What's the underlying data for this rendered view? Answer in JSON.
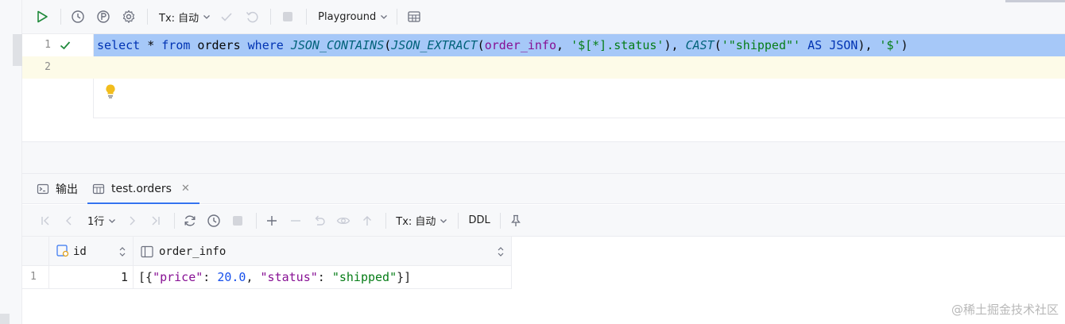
{
  "toolbar": {
    "tx_label": "Tx: 自动",
    "playground_label": "Playground"
  },
  "editor": {
    "lines": [
      {
        "number": "1"
      },
      {
        "number": "2"
      }
    ],
    "code": {
      "t1": "select",
      "t2": " * ",
      "t3": "from",
      "t4": " orders ",
      "t5": "where",
      "t6": " ",
      "t7": "JSON_CONTAINS",
      "t8": "(",
      "t9": "JSON_EXTRACT",
      "t10": "(",
      "t11": "order_info",
      "t12": ", ",
      "t13": "'$[*].status'",
      "t14": "), ",
      "t15": "CAST",
      "t16": "(",
      "t17": "'\"shipped\"'",
      "t18": " ",
      "t19": "AS",
      "t20": " ",
      "t21": "JSON",
      "t22": "), ",
      "t23": "'$'",
      "t24": ")"
    }
  },
  "results": {
    "tabs": [
      {
        "label": "输出"
      },
      {
        "label": "test.orders"
      }
    ],
    "toolbar": {
      "rows_label": "1行",
      "tx_label": "Tx: 自动",
      "ddl_label": "DDL"
    },
    "columns": [
      {
        "name": "id"
      },
      {
        "name": "order_info"
      }
    ],
    "rows": [
      {
        "rownum": "1",
        "id": "1",
        "info": {
          "p1": "[{",
          "p2": "\"price\"",
          "p3": ": ",
          "p4": "20.0",
          "p5": ", ",
          "p6": "\"status\"",
          "p7": ": ",
          "p8": "\"shipped\"",
          "p9": "}]"
        }
      }
    ]
  },
  "watermark": "@稀土掘金技术社区",
  "colors": {
    "selection": "#a6c8f8",
    "keyword": "#0033b3",
    "string": "#067d17",
    "accent": "#3574f0"
  }
}
